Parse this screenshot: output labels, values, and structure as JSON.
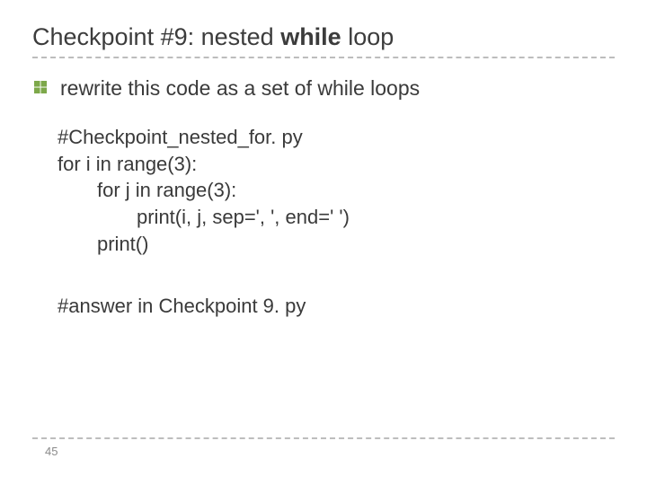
{
  "title_pre": "Checkpoint #9: nested ",
  "title_bold": "while",
  "title_post": " loop",
  "bullet": "rewrite this code as a set of while loops",
  "code": {
    "l1": "#Checkpoint_nested_for. py",
    "l2": "for i in range(3):",
    "l3": "for j in range(3):",
    "l4": "print(i, j, sep=', ', end=' ')",
    "l5": "print()"
  },
  "answer": "#answer in Checkpoint 9. py",
  "page": "45"
}
